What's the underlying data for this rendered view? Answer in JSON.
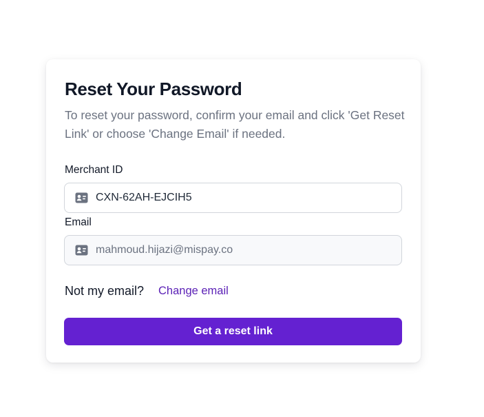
{
  "card": {
    "title": "Reset Your Password",
    "subtitle": "To reset your password, confirm your email and click 'Get Reset Link' or choose 'Change Email' if needed."
  },
  "merchant_id": {
    "label": "Merchant ID",
    "value": "CXN-62AH-EJCIH5",
    "icon": "id-card-icon"
  },
  "email": {
    "label": "Email",
    "value": "mahmoud.hijazi@mispay.co",
    "icon": "id-card-icon",
    "disabled": true
  },
  "change_email": {
    "prompt": "Not my email?",
    "link_label": "Change email"
  },
  "submit": {
    "label": "Get a reset link"
  },
  "colors": {
    "primary": "#6421d1",
    "link": "#5b21b6",
    "title": "#111827",
    "muted": "#6b7280",
    "border": "#d1d5db"
  }
}
